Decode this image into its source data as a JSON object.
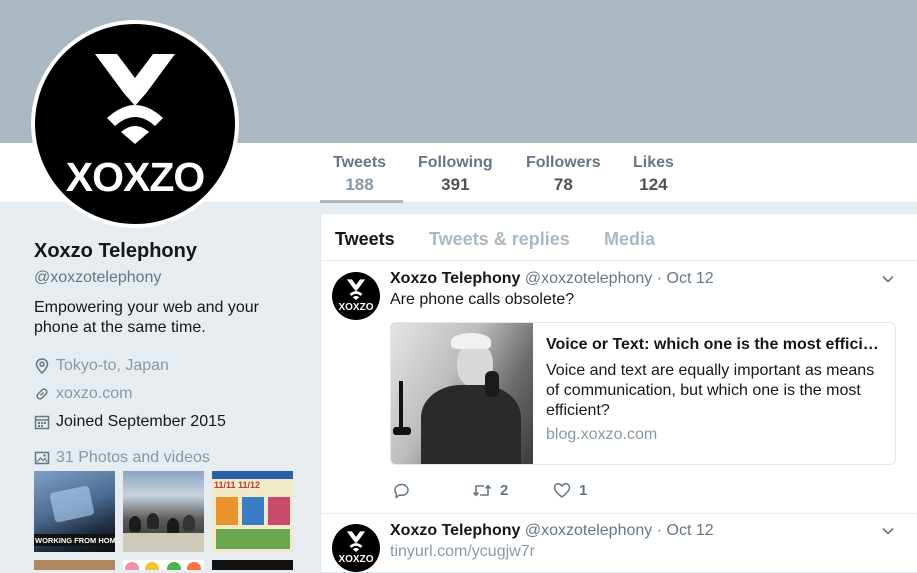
{
  "profile": {
    "name": "Xoxzo Telephony",
    "handle": "@xoxzotelephony",
    "bio": "Empowering your web and your phone at the same time.",
    "location": "Tokyo-to, Japan",
    "website": "xoxzo.com",
    "joined": "Joined September 2015",
    "photos_label": "31 Photos and videos",
    "avatar_text": "XOXZO"
  },
  "stats": [
    {
      "label": "Tweets",
      "value": "188"
    },
    {
      "label": "Following",
      "value": "391"
    },
    {
      "label": "Followers",
      "value": "78"
    },
    {
      "label": "Likes",
      "value": "124"
    }
  ],
  "tabs": [
    {
      "label": "Tweets"
    },
    {
      "label": "Tweets & replies"
    },
    {
      "label": "Media"
    }
  ],
  "tweets": [
    {
      "name": "Xoxzo Telephony",
      "handle": "@xoxzotelephony",
      "date": "· Oct 12",
      "text": "Are phone calls obsolete?",
      "card": {
        "title": "Voice or Text: which one is the most effici…",
        "description": "Voice and text are equally important as means of communication, but which one is the most efficient?",
        "domain": "blog.xoxzo.com"
      },
      "retweets": "2",
      "likes": "1"
    },
    {
      "name": "Xoxzo Telephony",
      "handle": "@xoxzotelephony",
      "date": "· Oct 12",
      "link": "tinyurl.com/ycugjw7r"
    }
  ],
  "photo_tiles": [
    {
      "caption": "WORKING FROM HOME"
    },
    {
      "caption": ""
    },
    {
      "caption": "11/11 11/12"
    }
  ],
  "colors": {
    "banner": "#a9b8c2",
    "background": "#e6ecf0",
    "secondary_text": "#657786",
    "muted_text": "#8899a6"
  }
}
